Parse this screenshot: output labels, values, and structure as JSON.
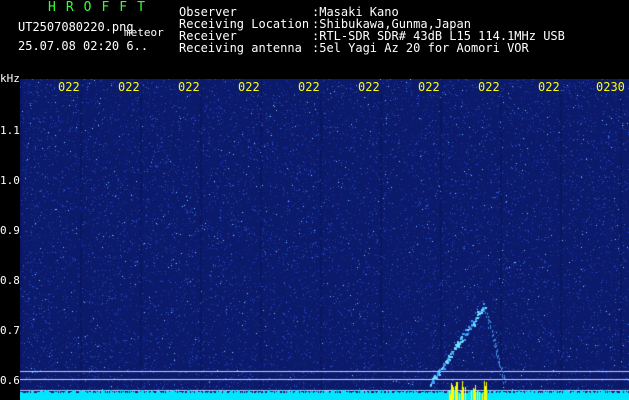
{
  "colors": {
    "accent_green": "#33ff33",
    "text_white": "#ffffff",
    "tick_yellow": "#ffff00",
    "bg": "#000000",
    "field": "#0d1d6b"
  },
  "header": {
    "logo": "HROFFT",
    "filename": "UT2507080220.png",
    "tag": "meteor",
    "timestamp": "25.07.08 02:20   6..",
    "fields": [
      {
        "label": "Observer",
        "value": ":Masaki Kano"
      },
      {
        "label": "Receiving Location",
        "value": ":Shibukawa,Gunma,Japan"
      },
      {
        "label": "Receiver",
        "value": ":RTL-SDR SDR# 43dB L15 114.1MHz USB"
      },
      {
        "label": "Receiving antenna",
        "value": ":5el Yagi Az 20 for Aomori VOR"
      }
    ]
  },
  "axis": {
    "y_unit": "kHz",
    "y_ticks": [
      "1.1",
      "1.0",
      "0.9",
      "0.8",
      "0.7",
      "0.6"
    ],
    "x_ticks": [
      "022",
      "022",
      "022",
      "022",
      "022",
      "022",
      "022",
      "022",
      "022",
      "0230"
    ]
  }
}
